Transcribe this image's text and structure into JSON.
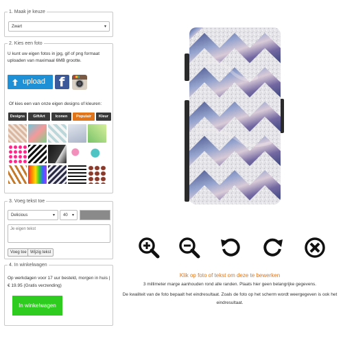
{
  "step1": {
    "legend": "1. Maak je keuze",
    "selected": "Zwart",
    "caret": "▾"
  },
  "step2": {
    "legend": "2. Kies een foto",
    "intro": "U kunt uw eigen fotos in jpg, gif of png formaat uploaden van maximaal 6MB grootte.",
    "upload_label": "upload",
    "or_text": "Of kies een van onze eigen designs of kleuren:",
    "tabs": [
      "Designs",
      "GiftArt",
      "Iconen",
      "Populair",
      "Kleur"
    ],
    "active_tab": "Populair",
    "icons": [
      "facebook-icon",
      "instagram-icon",
      "upload-arrow-icon"
    ]
  },
  "step3": {
    "legend": "3. Voeg tekst toe",
    "font": "Delicious",
    "size": "40",
    "text_placeholder": "Je eigen tekst",
    "add_label": "Voeg toe",
    "edit_label": "Wijzig tekst",
    "caret": "▾"
  },
  "step4": {
    "legend": "4. In winkelwagen",
    "shipping": "Op werkdagen voor 17 uur besteld, morgen in huis | € 19.95 (Gratis verzending)",
    "cart_label": "In winkelwagen"
  },
  "toolbar": {
    "icons": [
      "zoom-in-icon",
      "zoom-out-icon",
      "rotate-left-icon",
      "rotate-right-icon",
      "remove-icon"
    ]
  },
  "captions": {
    "click_hint": "Klik op foto of tekst om deze te bewerken",
    "margin_note": "3 millimeter marge aanhouden rond alle randen. Plaats hier geen belangrijke gegevens.",
    "quality_note": "De kwaliteit van de foto bepaalt het eindresultaat. Zoals de foto op het scherm wordt weergegeven is ook het eindresultaat."
  },
  "colors": {
    "accent_orange": "#e0751b",
    "upload_blue": "#1e90d6",
    "cart_green": "#2ecc1e",
    "facebook_blue": "#3b5998",
    "tab_dark": "#3a3a3a"
  }
}
